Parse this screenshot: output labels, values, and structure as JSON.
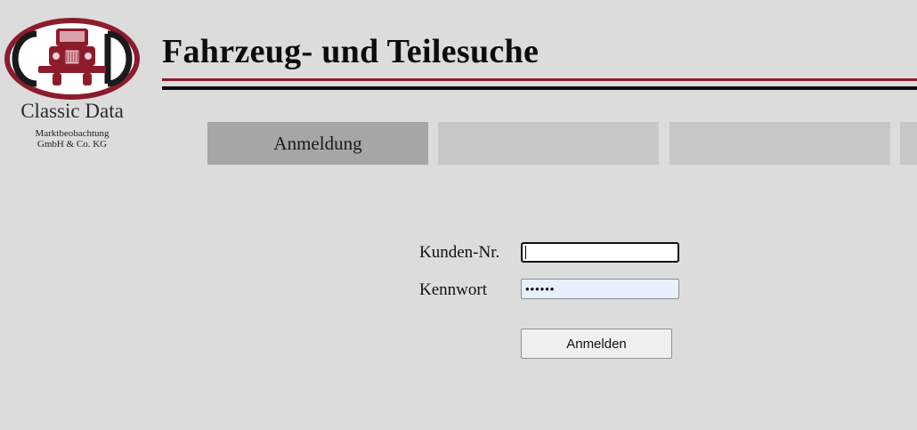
{
  "logo": {
    "name": "Classic Data",
    "subtitle_line1": "Marktbeobachtung",
    "subtitle_line2": "GmbH & Co. KG"
  },
  "header": {
    "title": "Fahrzeug- und Teilesuche"
  },
  "tabs": [
    {
      "label": "Anmeldung",
      "active": true
    },
    {
      "label": "",
      "active": false
    },
    {
      "label": "",
      "active": false
    },
    {
      "label": "",
      "active": false
    }
  ],
  "login_form": {
    "customer_number_label": "Kunden-Nr.",
    "customer_number_value": "",
    "password_label": "Kennwort",
    "password_value": "••••••",
    "submit_label": "Anmelden"
  },
  "colors": {
    "background": "#dcdcdc",
    "brand_red": "#8c1c2c",
    "tab_active": "#a6a6a6",
    "tab_inactive": "#c8c8c8",
    "autofill": "#e8f0fe"
  }
}
